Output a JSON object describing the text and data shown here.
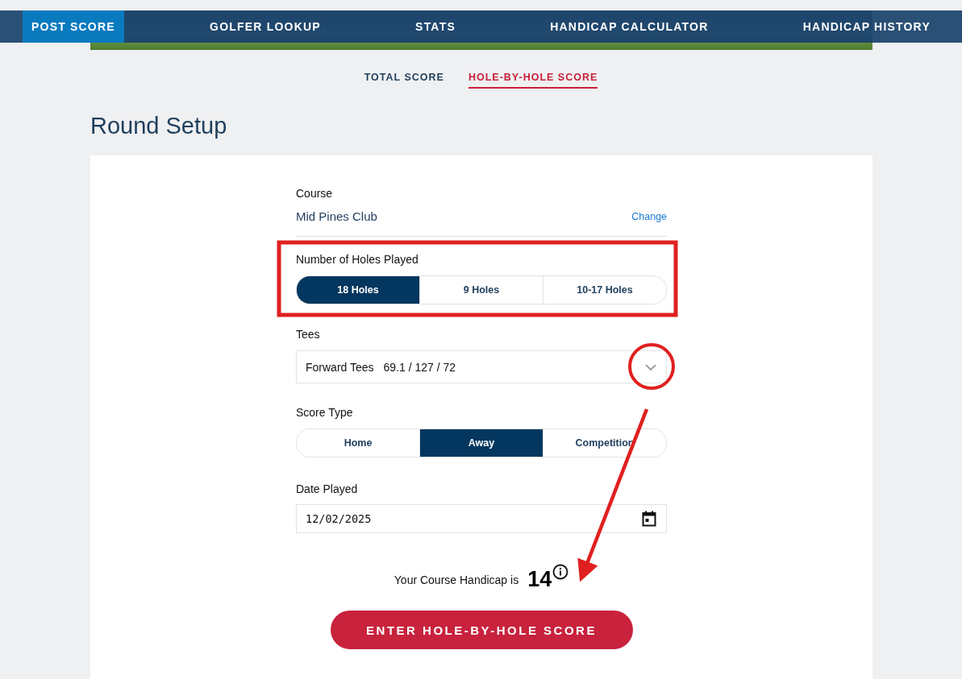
{
  "nav": [
    {
      "label": "POST SCORE",
      "selected": true
    },
    {
      "label": "GOLFER LOOKUP",
      "selected": false
    },
    {
      "label": "STATS",
      "selected": false
    },
    {
      "label": "HANDICAP CALCULATOR",
      "selected": false
    },
    {
      "label": "HANDICAP HISTORY",
      "selected": false
    }
  ],
  "subtabs": [
    {
      "label": "TOTAL SCORE",
      "selected": false
    },
    {
      "label": "HOLE-BY-HOLE SCORE",
      "selected": true
    }
  ],
  "heading": "Round Setup",
  "course": {
    "label": "Course",
    "name": "Mid Pines Club",
    "change": "Change"
  },
  "holes": {
    "label": "Number of Holes Played",
    "options": [
      {
        "label": "18 Holes",
        "selected": true
      },
      {
        "label": "9 Holes",
        "selected": false
      },
      {
        "label": "10-17 Holes",
        "selected": false
      }
    ]
  },
  "tees": {
    "label": "Tees",
    "name": "Forward Tees",
    "rating": "69.1 / 127 / 72"
  },
  "score_type": {
    "label": "Score Type",
    "options": [
      {
        "label": "Home",
        "selected": false
      },
      {
        "label": "Away",
        "selected": true
      },
      {
        "label": "Competition",
        "selected": false
      }
    ]
  },
  "date": {
    "label": "Date Played",
    "value": "12/02/2025"
  },
  "handicap": {
    "label": "Your Course Handicap is",
    "value": "14"
  },
  "submit": "ENTER HOLE-BY-HOLE SCORE"
}
